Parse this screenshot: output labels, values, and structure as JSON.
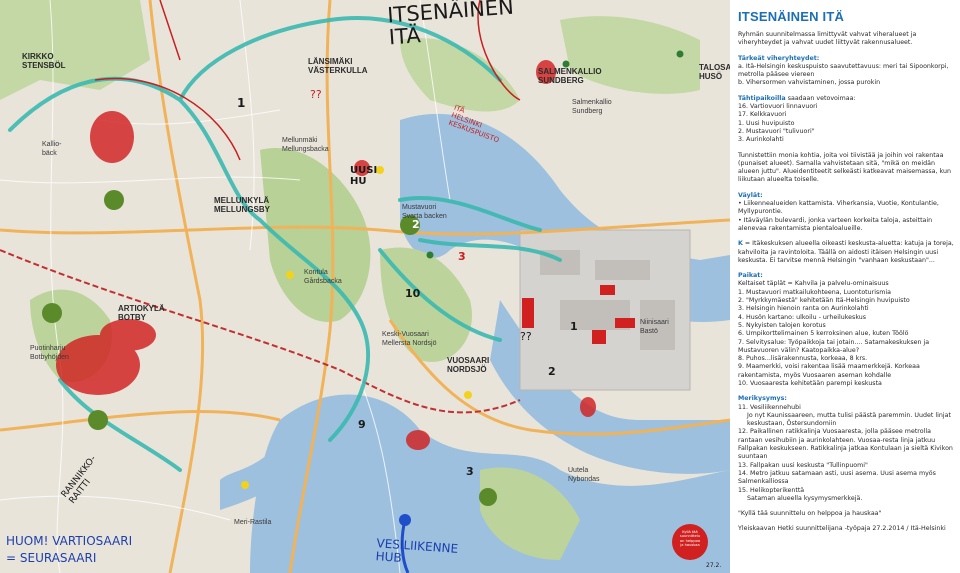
{
  "map": {
    "places": [
      {
        "id": "kirkko",
        "text": "Kirkko\nStensböl"
      },
      {
        "id": "lansimaki",
        "text": "LÄNSIMÄKI\nVÄSTERKULLA"
      },
      {
        "id": "salmenkallio",
        "text": "SALMENKALLIO\nSUNDBERG"
      },
      {
        "id": "salmenkallio2",
        "text": "Salmenkallio\nSundberg"
      },
      {
        "id": "talosaari",
        "text": "TALOSAARI\nHUSÖ"
      },
      {
        "id": "kallioba",
        "text": "Kallio-\nbäck"
      },
      {
        "id": "mellunmaki",
        "text": "Mellunmäki\nMellungsbacka"
      },
      {
        "id": "mellunkyla",
        "text": "MELLUNKYLÄ\nMELLUNGSBY"
      },
      {
        "id": "mustavuori",
        "text": "Mustavuori\nSvarta backen"
      },
      {
        "id": "kontula",
        "text": "Kontula\nGårdsbacka"
      },
      {
        "id": "vartiokyla",
        "text": "ARTIOKYLÄ\nBOTBY"
      },
      {
        "id": "puotinharju",
        "text": "Puotinharju\nBotbyhöjden"
      },
      {
        "id": "keski",
        "text": "Keski-Vuosaari\nMellersta Nordsjö"
      },
      {
        "id": "vuosaari",
        "text": "VUOSAARI\nNORDSJÖ"
      },
      {
        "id": "niinisaari",
        "text": "Niinisaari\nBastö"
      },
      {
        "id": "uutela",
        "text": "Uutela\nNybondas"
      },
      {
        "id": "merirastila",
        "text": "Meri-Rastila"
      }
    ],
    "handwriting": {
      "itsenainen": "ITSENÄINEN\nITÄ",
      "itahelsinki": "ITÄ\nHELSINKI\nKESKUSPUISTO",
      "q1": "??",
      "q2": "??",
      "uusi": "UUSI\nHU",
      "rannikko": "RANNIKKO-\nRAITTI",
      "huom": "HUOM! VARTIOSAARI\n= SEURASAARI",
      "vesiliikenne": "VESILIIKENNE\nHUB",
      "date": "27.2.",
      "nos": [
        "1",
        "2",
        "1",
        "10",
        "3",
        "3",
        "2",
        "9"
      ]
    },
    "sticker": "Kyllä tää\nsuunnittelu\non helppoa\nja hauskaa",
    "colors": {
      "roads": "#f0b35a",
      "green": "#b9d39a",
      "water": "#8fb8d8",
      "teal": "#3bb9b0",
      "red": "#d12020"
    }
  },
  "panel": {
    "title": "ITSENÄINEN ITÄ",
    "intro": "Ryhmän suunnitelmassa limittyvät vahvat viheralueet ja viheryhteydet ja vahvat uudet liittyvät rakennusalueet.",
    "viher_head": "Tärkeät viheryhteydet:",
    "viher": [
      "a.  Itä-Helsingin keskuspuisto saavutettavuus: meri tai Sipoonkorpi, metrolla pääsee viereen",
      "b.  Vihersormen vahvistaminen, jossa purokin"
    ],
    "tahti_head": "Tähtipaikoilla",
    "tahti_rest": " saadaan vetovoimaa:",
    "tahti": [
      "16. Vartiovuori linnavuori",
      "17. Kelkkavuori",
      "1. Uusi huvipuisto",
      "2. Mustavuori \"tulivuori\"",
      "3. Aurinkolahti"
    ],
    "tunnistettiin": "Tunnistettiin monia kohtia, joita voi tiivistää ja joihin voi rakentaa (punaiset alueet). Samalla vahvistetaan sitä, \"mikä on meidän alueen juttu\". Alueidentiteetit selkeästi katkeavat maisemassa, kun liikutaan alueelta toiselle.",
    "vaylat_head": "Väylät:",
    "vaylat": [
      "•  Liikennealueiden kattamista. Viherkansia, Vuotie, Kontulantie, Myllypurontie.",
      "•  Itäväylän bulevardi, jonka varteen korkeita taloja, asteittain alenevaa rakentamista pientaloalueille."
    ],
    "k_key": "K",
    "k_text": " = Itäkeskuksen alueella oikeasti keskusta-aluetta: katuja ja toreja, kahviloita ja ravintoloita. Täällä on aidosti itäisen Helsingin uusi keskusta. Ei tarvitse mennä Helsingin \"vanhaan keskustaan\"...",
    "paikat_head": "Paikat:",
    "paikat_sub": "Keltaiset täplät = Kahvila ja palvelu-ominaisuus",
    "paikat": [
      "1.  Mustavuori matkailukohteena, Luontoturismia",
      "2.  \"Myrkkymäestä\" kehitetään Itä-Helsingin huvipuisto",
      "3.  Helsingin hienoin ranta on Aurinkolahti",
      "4.  Husön kartano: ulkoilu - urheilukeskus",
      "5.  Nykyisten talojen korotus",
      "6.  Umpikorttelimainen 5 kerroksinen alue, kuten Töölö",
      "7.  Selvitysalue: Työpaikkoja tai jotain.... Satamakeskuksen ja Mustavuoren välin? Kaatopaikka-alue?",
      "8.  Puhos...lisärakennusta, korkeaa, 8 krs.",
      "9.  Maamerkki, voisi rakentaa lisää maamerkkejä. Korkeaa rakentamista, myös Vuosaaren aseman kohdalle",
      "10. Vuosaaresta kehitetään parempi keskusta"
    ],
    "meri_head": "Merikysymys:",
    "meri": [
      "11.  Vesiliikennehubi",
      "      Jo nyt Kaunissaareen, mutta tulisi päästä paremmin. Uudet linjat keskustaan, Östersundomiin",
      "12.  Paikallinen ratikkalinja Vuosaaresta, jolla pääsee metrolla rantaan vesihubiin ja aurinkolahteen. Vuosaa-resta linja jatkuu Fallpakan keskukseen. Ratikkalinja jatkaa Kontulaan ja sieltä Kivikon suuntaan",
      "13.  Fallpakan uusi keskusta \"Tullinpuomi\"",
      "14.  Metro jatkuu satamaan asti, uusi asema. Uusi asema myös Salmenkalliossa",
      "15.  Helikopterikenttä",
      "      Sataman alueella kysymysmerkkejä."
    ],
    "quote": "\"Kyllä tää suunnittelu on helppoa ja  hauskaa\"",
    "footer": "Yleiskaavan Hetki suunnittelijana -työpaja 27.2.2014 / Itä-Helsinki"
  }
}
